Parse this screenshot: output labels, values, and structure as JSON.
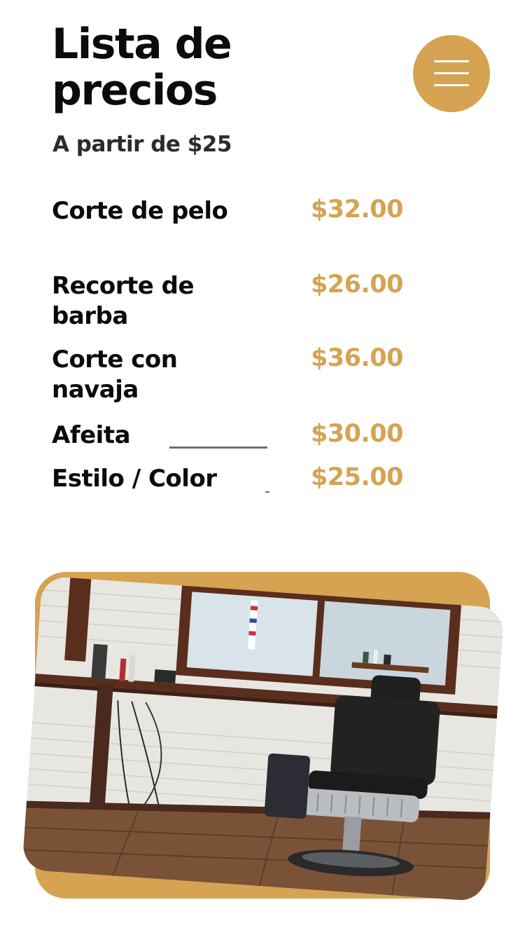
{
  "header": {
    "title": "Lista de precios",
    "subtitle": "A partir de $25",
    "menu_icon": "hamburger-menu-icon"
  },
  "prices": [
    {
      "name": "Corte de pelo",
      "price": "$32.00"
    },
    {
      "name": "Recorte de barba",
      "price": "$26.00"
    },
    {
      "name": "Corte con navaja",
      "price": "$36.00"
    },
    {
      "name": "Afeita",
      "price": "$30.00"
    },
    {
      "name": "Estilo / Color",
      "price": "$25.00"
    }
  ],
  "colors": {
    "accent": "#d5a352",
    "text": "#0b0b0b",
    "background": "#ffffff"
  }
}
